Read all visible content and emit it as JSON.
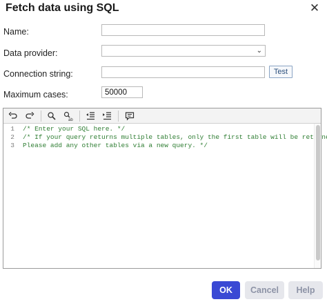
{
  "dialog": {
    "title": "Fetch data using SQL",
    "close_glyph": "✕"
  },
  "form": {
    "name_label": "Name:",
    "name_value": "",
    "provider_label": "Data provider:",
    "provider_value": "",
    "connection_label": "Connection string:",
    "connection_value": "",
    "test_label": "Test",
    "max_cases_label": "Maximum cases:",
    "max_cases_value": "50000"
  },
  "toolbar": {
    "icons": [
      "undo-icon",
      "redo-icon",
      "search-icon",
      "find-replace-icon",
      "outdent-icon",
      "indent-icon",
      "comment-icon"
    ]
  },
  "editor": {
    "line_numbers": [
      "1",
      "2",
      "3"
    ],
    "lines": [
      "/* Enter your SQL here. */",
      "/* If your query returns multiple tables, only the first table will be returned.",
      "Please add any other tables via a new query. */"
    ],
    "comment_color": "#2e7d32"
  },
  "footer": {
    "ok_label": "OK",
    "cancel_label": "Cancel",
    "help_label": "Help",
    "ok_color": "#3a49d4"
  }
}
